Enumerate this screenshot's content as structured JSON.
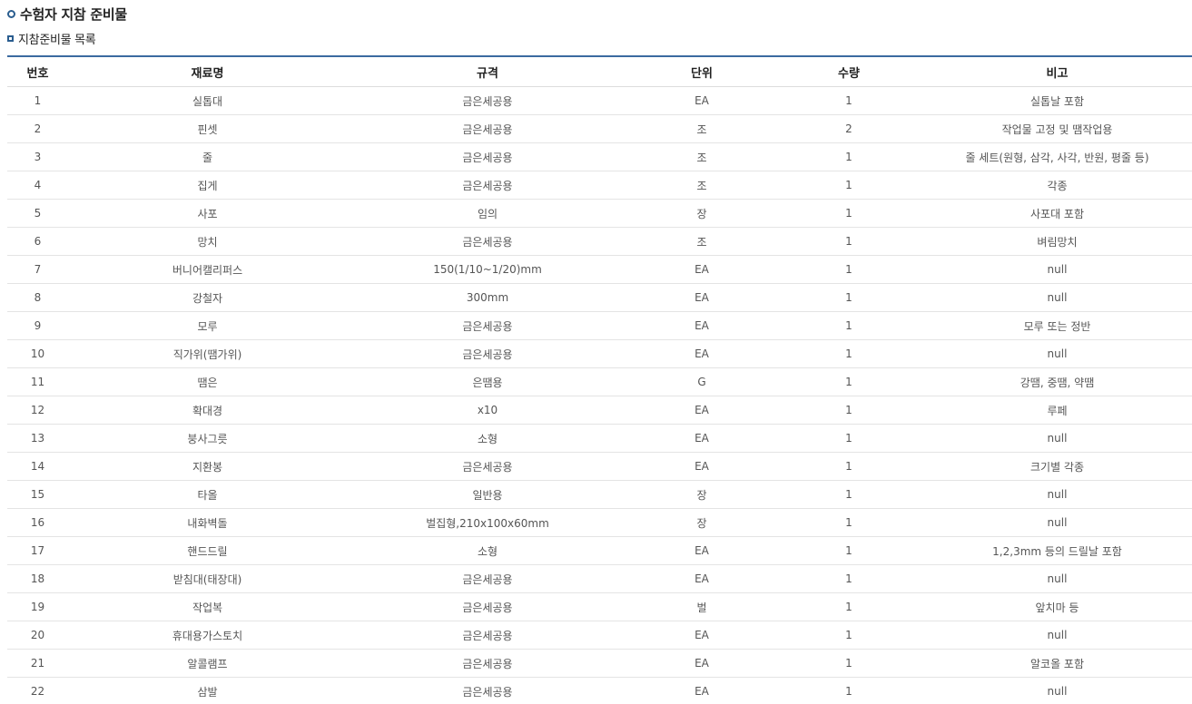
{
  "header": {
    "title": "수험자 지참 준비물",
    "subtitle": "지참준비물 목록"
  },
  "table": {
    "columns": [
      "번호",
      "재료명",
      "규격",
      "단위",
      "수량",
      "비고"
    ],
    "rows": [
      [
        "1",
        "실톱대",
        "금은세공용",
        "EA",
        "1",
        "실톱날 포함"
      ],
      [
        "2",
        "핀셋",
        "금은세공용",
        "조",
        "2",
        "작업물 고정 및 땜작업용"
      ],
      [
        "3",
        "줄",
        "금은세공용",
        "조",
        "1",
        "줄 세트(원형, 삼각, 사각, 반원, 평줄 등)"
      ],
      [
        "4",
        "집게",
        "금은세공용",
        "조",
        "1",
        "각종"
      ],
      [
        "5",
        "사포",
        "임의",
        "장",
        "1",
        "사포대 포함"
      ],
      [
        "6",
        "망치",
        "금은세공용",
        "조",
        "1",
        "벼림망치"
      ],
      [
        "7",
        "버니어캘리퍼스",
        "150(1/10~1/20)mm",
        "EA",
        "1",
        "null"
      ],
      [
        "8",
        "강철자",
        "300mm",
        "EA",
        "1",
        "null"
      ],
      [
        "9",
        "모루",
        "금은세공용",
        "EA",
        "1",
        "모루 또는 정반"
      ],
      [
        "10",
        "직가위(땜가위)",
        "금은세공용",
        "EA",
        "1",
        "null"
      ],
      [
        "11",
        "땜은",
        "은땜용",
        "G",
        "1",
        "강땜, 중땜, 약땜"
      ],
      [
        "12",
        "확대경",
        "x10",
        "EA",
        "1",
        "루페"
      ],
      [
        "13",
        "붕사그릇",
        "소형",
        "EA",
        "1",
        "null"
      ],
      [
        "14",
        "지환봉",
        "금은세공용",
        "EA",
        "1",
        "크기별 각종"
      ],
      [
        "15",
        "타올",
        "일반용",
        "장",
        "1",
        "null"
      ],
      [
        "16",
        "내화벽돌",
        "벌집형,210x100x60mm",
        "장",
        "1",
        "null"
      ],
      [
        "17",
        "핸드드릴",
        "소형",
        "EA",
        "1",
        "1,2,3mm 등의 드릴날 포함"
      ],
      [
        "18",
        "받침대(태장대)",
        "금은세공용",
        "EA",
        "1",
        "null"
      ],
      [
        "19",
        "작업복",
        "금은세공용",
        "벌",
        "1",
        "앞치마 등"
      ],
      [
        "20",
        "휴대용가스토치",
        "금은세공용",
        "EA",
        "1",
        "null"
      ],
      [
        "21",
        "알콜램프",
        "금은세공용",
        "EA",
        "1",
        "알코올 포함"
      ],
      [
        "22",
        "삼발",
        "금은세공용",
        "EA",
        "1",
        "null"
      ]
    ]
  },
  "colors": {
    "accent": "#3b6aa0",
    "bullet": "#2a5d8f"
  }
}
